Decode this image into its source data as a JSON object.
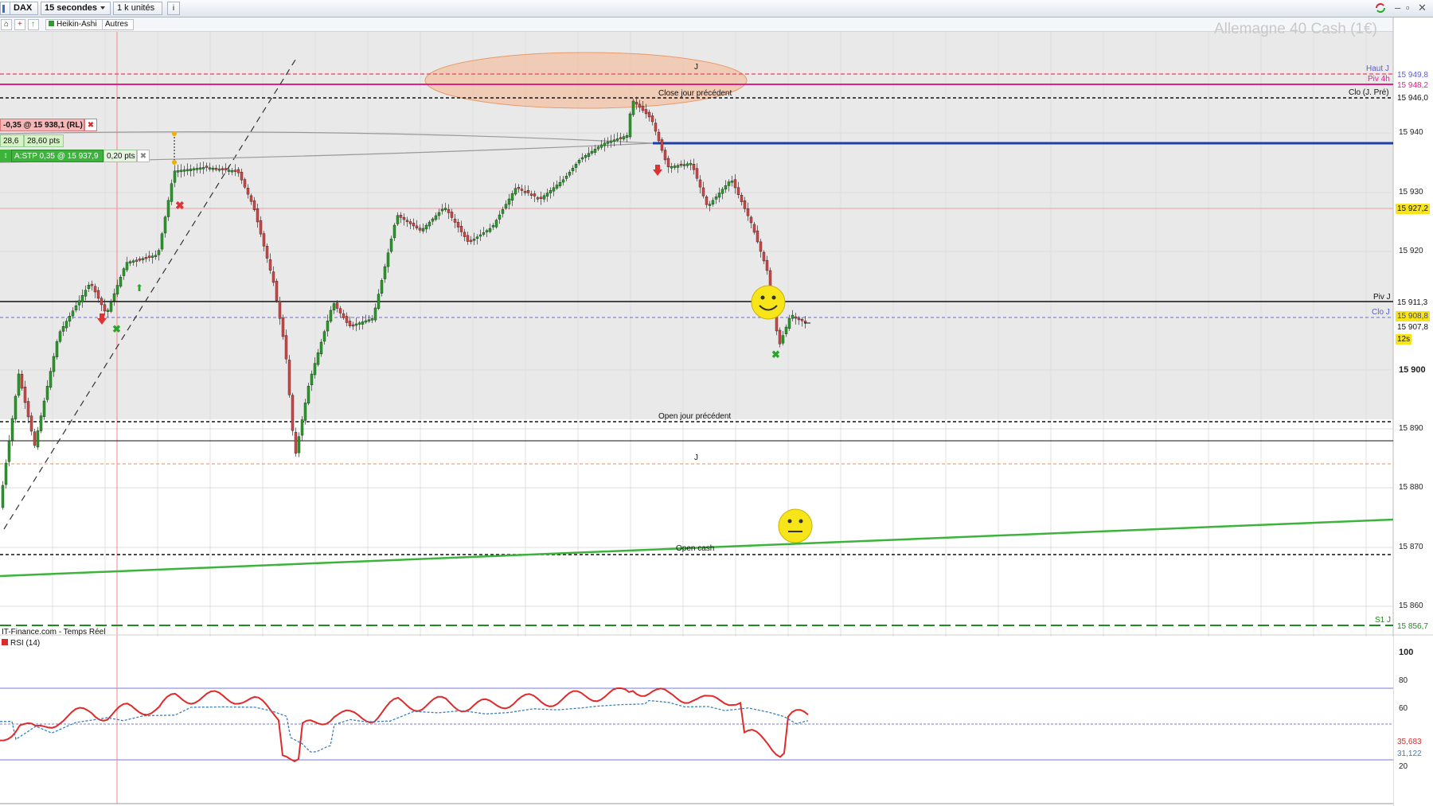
{
  "toolbar": {
    "instrument": "DAX",
    "interval": "15 secondes",
    "units": "1 k unités",
    "info_icon": "info-icon",
    "refresh_icon": "refresh-icon"
  },
  "toolbar2": {
    "heikin": "Heikin-Ashi",
    "autres": "Autres"
  },
  "chart": {
    "watermark": "Allemagne 40 Cash (1€)",
    "source": "IT-Finance.com - Temps Réel",
    "annotations": {
      "close_prev": "Close jour précédent",
      "open_prev": "Open jour précédent",
      "open_cash": "Open cash",
      "j_top": "J",
      "j_mid": "J"
    },
    "line_labels": {
      "haut_j": "Haut J",
      "piv_4h": "Piv 4h",
      "clo_prev": "Clo (J. Pré)",
      "piv_j": "Piv J",
      "clo_j": "Clo J",
      "s1_j": "S1 J"
    },
    "axis_ticks": [
      "15 940",
      "15 930",
      "15 920",
      "15 900",
      "15 890",
      "15 880",
      "15 870",
      "15 860"
    ],
    "price_tags": {
      "haut": "15 949,8",
      "piv4h": "15 948,2",
      "clo_prev": "15 946,0",
      "level1": "15 927,2",
      "pivj": "15 911,3",
      "cloj": "15 908,8",
      "last": "15 907,8",
      "timer": "12s",
      "s1": "15 856,7"
    },
    "orders": {
      "position": "-0,35 @ 15 938,1 (RL)",
      "pnl_a": "28,6",
      "pnl_b": "28,60 pts",
      "stop": "A:STP 0,35 @ 15 937,9",
      "stop_dist": "0,20 pts"
    },
    "colors": {
      "bull": "#2f9b2f",
      "bear": "#c94b4b",
      "green_trend": "#3cb43c",
      "blue_level": "#1f3fa8",
      "magenta": "#e0218a",
      "ellipse": "#f4b48a"
    }
  },
  "rsi": {
    "title": "RSI (14)",
    "ticks": [
      "100",
      "80",
      "60",
      "20"
    ],
    "value1": "35,683",
    "value2": "31,122"
  }
}
